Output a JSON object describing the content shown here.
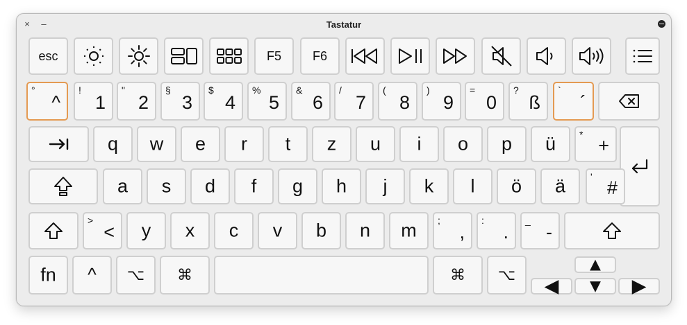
{
  "window": {
    "title": "Tastatur",
    "close_label": "×",
    "minimize_label": "–"
  },
  "rows": {
    "fn": {
      "esc": "esc",
      "f5": "F5",
      "f6": "F6"
    },
    "numbers": [
      {
        "main": "^",
        "sub": "°"
      },
      {
        "main": "1",
        "sub": "!"
      },
      {
        "main": "2",
        "sub": "\""
      },
      {
        "main": "3",
        "sub": "§"
      },
      {
        "main": "4",
        "sub": "$"
      },
      {
        "main": "5",
        "sub": "%"
      },
      {
        "main": "6",
        "sub": "&"
      },
      {
        "main": "7",
        "sub": "/"
      },
      {
        "main": "8",
        "sub": "("
      },
      {
        "main": "9",
        "sub": ")"
      },
      {
        "main": "0",
        "sub": "="
      },
      {
        "main": "ß",
        "sub": "?"
      },
      {
        "main": "´",
        "sub": "`"
      }
    ],
    "qwertz": [
      "q",
      "w",
      "e",
      "r",
      "t",
      "z",
      "u",
      "i",
      "o",
      "p",
      "ü"
    ],
    "plus": {
      "main": "+",
      "sub": "*"
    },
    "asdf": [
      "a",
      "s",
      "d",
      "f",
      "g",
      "h",
      "j",
      "k",
      "l",
      "ö",
      "ä"
    ],
    "hash": {
      "main": "#",
      "sub": "'"
    },
    "angle": {
      "main": "<",
      "sub": ">"
    },
    "yxcv": [
      "y",
      "x",
      "c",
      "v",
      "b",
      "n",
      "m"
    ],
    "comma": {
      "main": ",",
      "sub": ";"
    },
    "period": {
      "main": ".",
      "sub": ":"
    },
    "minus": {
      "main": "-",
      "sub": "_"
    },
    "bottom": {
      "fn": "fn",
      "control": "^",
      "option": "⌥",
      "command": "⌘",
      "arrow_up": "▲",
      "arrow_left": "◀",
      "arrow_down": "▼",
      "arrow_right": "▶"
    }
  },
  "highlighted_keys": [
    "caret-key",
    "acute-key"
  ],
  "colors": {
    "highlight": "#e49a52",
    "key_bg": "#f7f7f7",
    "key_border": "#cfcfcf",
    "window_bg": "#ececec"
  }
}
